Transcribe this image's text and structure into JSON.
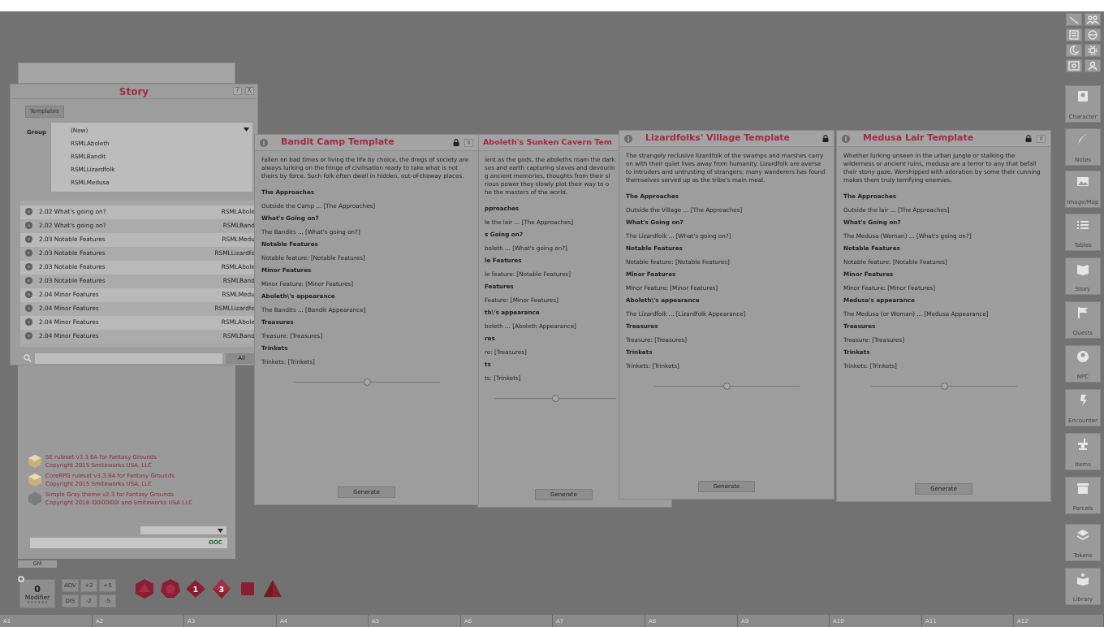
{
  "story_window": {
    "title": "Story",
    "help": "?",
    "close": "X",
    "tab": "Templates",
    "group_label": "Group",
    "group_options": [
      {
        "label": "(New)"
      },
      {
        "label": "RSMLAboleth"
      },
      {
        "label": "RSMLBandit"
      },
      {
        "label": "RSMLLizardfolk"
      },
      {
        "label": "RSMLMedusa"
      }
    ],
    "entries": [
      {
        "title": "2.02 What's going on?",
        "group": "RSMLAbole"
      },
      {
        "title": "2.02 What's going on?",
        "group": "RSMLBand"
      },
      {
        "title": "2.03 Notable Features",
        "group": "RSMLMedu"
      },
      {
        "title": "2.03 Notable Features",
        "group": "RSMLLizardfo"
      },
      {
        "title": "2.03 Notable Features",
        "group": "RSMLAbole"
      },
      {
        "title": "2.03 Notable Features",
        "group": "RSMLBand"
      },
      {
        "title": "2.04 Minor Features",
        "group": "RSMLMedu"
      },
      {
        "title": "2.04 Minor Features",
        "group": "RSMLLizardfo"
      },
      {
        "title": "2.04 Minor Features",
        "group": "RSMLAbole"
      },
      {
        "title": "2.04 Minor Features",
        "group": "RSMLBand"
      }
    ],
    "filter_button": "All"
  },
  "templates": [
    {
      "title": "Bandit Camp Template",
      "close": "x",
      "description": "Fallen on bad times or living the life by choice, the dregs of society are always lurking on the fringe of civilisation ready to take what is not theirs by force. Such folk often dwell in hidden, out-of-theway places.",
      "lines": [
        {
          "kind": "heading",
          "text": "The Approaches"
        },
        {
          "kind": "text",
          "text": "Outside the Camp ... [The Approaches]"
        },
        {
          "kind": "heading",
          "text": "What's Going on?"
        },
        {
          "kind": "text",
          "text": "The Bandits ... [What's going on?]"
        },
        {
          "kind": "heading",
          "text": "Notable Features"
        },
        {
          "kind": "text",
          "text": "Notable feature: [Notable Features]"
        },
        {
          "kind": "heading",
          "text": "Minor Features"
        },
        {
          "kind": "text",
          "text": "Minor Feature: [Minor Features]"
        },
        {
          "kind": "heading",
          "text": "Aboleth\\'s appearance"
        },
        {
          "kind": "text",
          "text": "The Bandits ... [Bandit Appearance]"
        },
        {
          "kind": "heading",
          "text": "Treasures"
        },
        {
          "kind": "text",
          "text": "Treasure: [Treasures]"
        },
        {
          "kind": "heading",
          "text": "Trinkets"
        },
        {
          "kind": "text",
          "text": "Trinkets: [Trinkets]"
        }
      ],
      "level": 0.5,
      "button": "Generate"
    },
    {
      "title": "Aboleth's Sunken Cavern Tem",
      "description_lines": [
        "ient as the gods, the aboleths roam the dark",
        "ses and earth capturing slaves and devourin",
        "g ancient memories, thoughts from their sl",
        "rious power they slowly plot their way to o",
        "he the masters of the world."
      ],
      "lines": [
        {
          "kind": "heading",
          "text": "pproaches"
        },
        {
          "kind": "text",
          "text": "le the lair ... [The Approaches]"
        },
        {
          "kind": "heading",
          "text": "s Going on?"
        },
        {
          "kind": "text",
          "text": "boleth ... [What's going on?]"
        },
        {
          "kind": "heading",
          "text": "le Features"
        },
        {
          "kind": "text",
          "text": "le feature: [Notable Features]"
        },
        {
          "kind": "heading",
          "text": "Features"
        },
        {
          "kind": "text",
          "text": "Feature: [Minor Features]"
        },
        {
          "kind": "heading",
          "text": "th\\'s appearance"
        },
        {
          "kind": "text",
          "text": "boleth ... [Aboleth Appearance]"
        },
        {
          "kind": "heading",
          "text": "res"
        },
        {
          "kind": "text",
          "text": "re: [Treasures]"
        },
        {
          "kind": "heading",
          "text": "ts"
        },
        {
          "kind": "text",
          "text": "ts: [Trinkets]"
        }
      ],
      "level": 0.5,
      "button": "Generate"
    },
    {
      "title": "Lizardfolks' Village Template",
      "description": "The strangely reclusive lizardfolk of the swamps and marshes carry on with their quiet lives away from humanity. Lizardfolk are averse to intruders and untrusting of strangers; many wanderers has found themselves served up as the tribe's main meal.",
      "lines": [
        {
          "kind": "heading",
          "text": "The Approaches"
        },
        {
          "kind": "text",
          "text": "Outside the Village ... [The Approaches]"
        },
        {
          "kind": "heading",
          "text": "What's Going on?"
        },
        {
          "kind": "text",
          "text": "The Lizardfolk ... [What's going on?]"
        },
        {
          "kind": "heading",
          "text": "Notable Features"
        },
        {
          "kind": "text",
          "text": "Notable feature: [Notable Features]"
        },
        {
          "kind": "heading",
          "text": "Minor Features"
        },
        {
          "kind": "text",
          "text": "Minor Feature: [Minor Features]"
        },
        {
          "kind": "heading",
          "text": "Aboleth\\'s appearance"
        },
        {
          "kind": "text",
          "text": "The Lizardfolk ... [Lizardfolk Appearance]"
        },
        {
          "kind": "heading",
          "text": "Treasures"
        },
        {
          "kind": "text",
          "text": "Treasure: [Treasures]"
        },
        {
          "kind": "heading",
          "text": "Trinkets"
        },
        {
          "kind": "text",
          "text": "Trinkets: [Trinkets]"
        }
      ],
      "level": 0.5,
      "button": "Generate"
    },
    {
      "title": "Medusa Lair Template",
      "close": "x",
      "description": "Whether lurking unseen in the urban jungle or stalking the wilderness or ancient ruins, medusa are a terror to any that befall their stony gaze. Worshipped with adoration by some their cunning makes them truly terrifying enemies.",
      "lines": [
        {
          "kind": "heading",
          "text": "The Approaches"
        },
        {
          "kind": "text",
          "text": "Outside the lair ... [The Approaches]"
        },
        {
          "kind": "heading",
          "text": "What's Going on?"
        },
        {
          "kind": "text",
          "text": "The Medusa (Woman) ... [What's going on?]"
        },
        {
          "kind": "heading",
          "text": "Notable Features"
        },
        {
          "kind": "text",
          "text": "Notable feature: [Notable Features]"
        },
        {
          "kind": "heading",
          "text": "Minor Features"
        },
        {
          "kind": "text",
          "text": "Minor Feature: [Minor Features]"
        },
        {
          "kind": "heading",
          "text": "Medusa's appearance"
        },
        {
          "kind": "text",
          "text": "The Medusa (or Woman) ... [Medusa Appearance]"
        },
        {
          "kind": "heading",
          "text": "Treasures"
        },
        {
          "kind": "text",
          "text": "Treasure: [Treasures]"
        },
        {
          "kind": "heading",
          "text": "Trinkets"
        },
        {
          "kind": "text",
          "text": "Trinkets: [Trinkets]"
        }
      ],
      "level": 0.5,
      "button": "Generate"
    }
  ],
  "chat": {
    "rulesets": [
      {
        "kind": "box",
        "name": "5E ruleset v3.3.6A for Fantasy Grounds",
        "copyright": "Copyright 2015 Smiteworks USA, LLC"
      },
      {
        "kind": "box",
        "name": "CoreRPG ruleset v3.3.6A for Fantasy Grounds",
        "copyright": "Copyright 2015 Smiteworks USA, LLC"
      },
      {
        "kind": "badge",
        "name": "Simple Gray theme v2.3 for Fantasy Grounds",
        "copyright": "Copyright 2018 l00l00l00l and Smiteworks USA LLC"
      }
    ],
    "mode": "OOC"
  },
  "identity_tab": "GM",
  "modifier": {
    "value": "0",
    "label": "Modifier"
  },
  "modifier_buttons": [
    "ADV",
    "+2",
    "+5",
    "DIS",
    "-2",
    "-5"
  ],
  "dice": [
    {
      "kind": "d20"
    },
    {
      "kind": "d12"
    },
    {
      "kind": "d10",
      "face": "1"
    },
    {
      "kind": "d8",
      "face": "3"
    },
    {
      "kind": "d6"
    },
    {
      "kind": "d4"
    }
  ],
  "sidebar": {
    "buttons": [
      {
        "label": "Character"
      },
      {
        "label": "Notes"
      },
      {
        "label": "Image/Map"
      },
      {
        "label": "Tables"
      },
      {
        "label": "Story"
      },
      {
        "label": "Quests"
      },
      {
        "label": "NPC"
      },
      {
        "label": "Encounter"
      },
      {
        "label": "Items"
      },
      {
        "label": "Parcels"
      },
      {
        "label": "Tokens"
      },
      {
        "label": "Library"
      }
    ]
  },
  "hotkey_bar": [
    "A1",
    "A2",
    "A3",
    "A4",
    "A5",
    "A6",
    "A7",
    "A8",
    "A9",
    "A10",
    "A11",
    "A12"
  ]
}
